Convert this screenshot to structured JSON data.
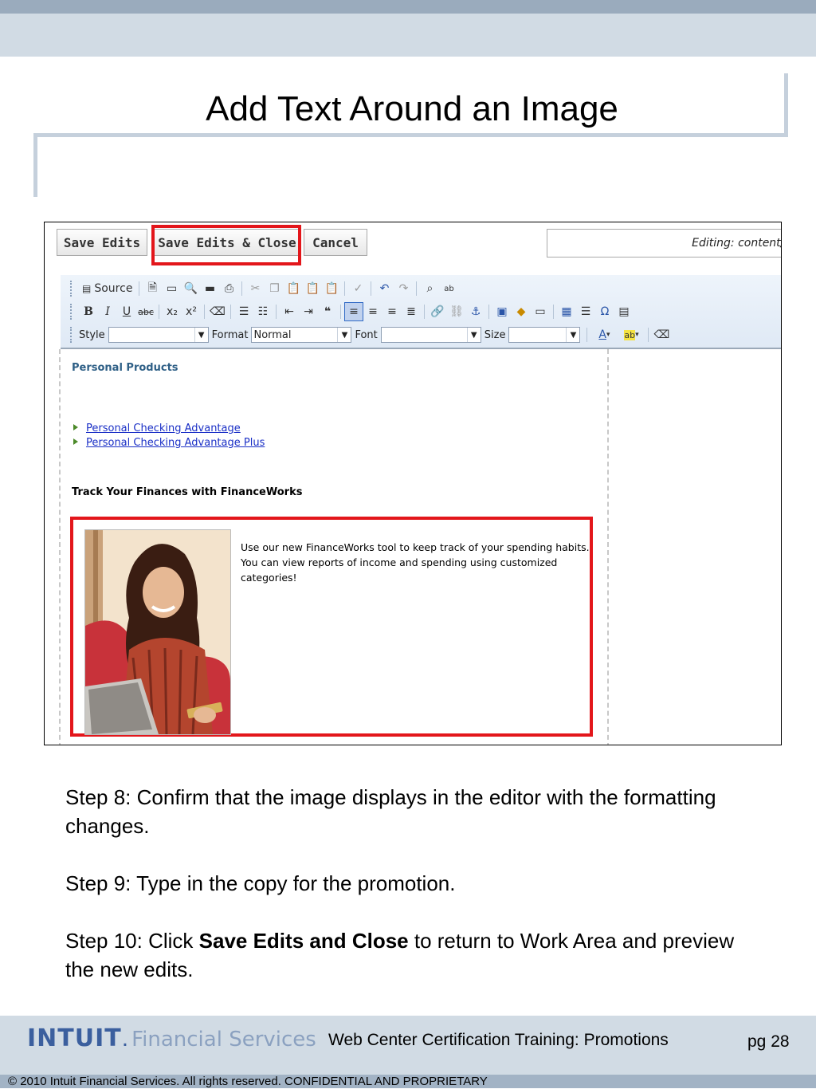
{
  "slide": {
    "title": "Add Text Around an Image"
  },
  "editor": {
    "buttons": {
      "save_edits": "Save Edits",
      "save_edits_close": "Save Edits & Close",
      "cancel": "Cancel"
    },
    "editing_label": "Editing: content/e",
    "toolbar": {
      "source_label": "Source",
      "style_label": "Style",
      "style_value": "",
      "format_label": "Format",
      "format_value": "Normal",
      "font_label": "Font",
      "font_value": "",
      "size_label": "Size",
      "size_value": ""
    },
    "content": {
      "section_heading": "Personal Products",
      "links": [
        "Personal Checking Advantage",
        "Personal Checking Advantage Plus"
      ],
      "track_heading": "Track Your Finances with FinanceWorks",
      "promo_copy": "Use our new FinanceWorks tool to keep track of your spending habits. You can view reports of income and spending using customized categories!"
    },
    "highlight_color": "#e3161b"
  },
  "steps": {
    "step8": "Step 8: Confirm that the image displays in the editor with the formatting changes.",
    "step9": "Step 9: Type in the copy for the promotion.",
    "step10_prefix": "Step 10: Click ",
    "step10_bold": "Save Edits and Close",
    "step10_suffix": " to return to Work Area and preview the new edits."
  },
  "footer": {
    "logo_brand": "INTUIT",
    "logo_dot": ".",
    "logo_sub": "Financial Services",
    "course_title": "Web Center Certification Training: Promotions",
    "page_number": "pg 28",
    "copyright": "© 2010 Intuit Financial Services. All rights reserved. CONFIDENTIAL AND PROPRIETARY"
  }
}
